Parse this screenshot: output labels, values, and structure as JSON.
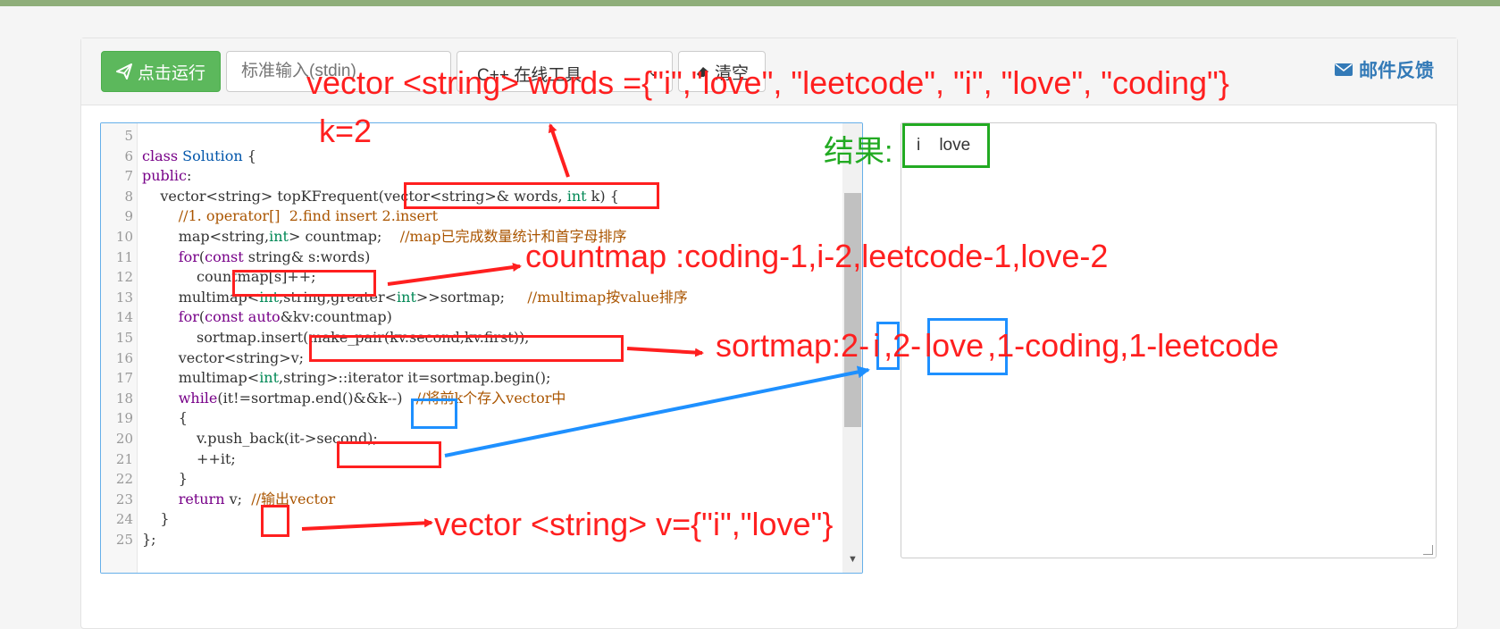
{
  "toolbar": {
    "run_label": "点击运行",
    "stdin_placeholder": "标准输入(stdin)",
    "language_selected": "C++ 在线工具",
    "clear_label": "清空",
    "feedback_label": "邮件反馈"
  },
  "editor": {
    "lines": [
      {
        "num": "5",
        "text": ""
      },
      {
        "num": "6",
        "text": "class Solution {"
      },
      {
        "num": "7",
        "text": "public:"
      },
      {
        "num": "8",
        "text": "    vector<string> topKFrequent(vector<string>& words, int k) {"
      },
      {
        "num": "9",
        "text": "        //1. operator[]  2.find insert 2.insert"
      },
      {
        "num": "10",
        "text": "        map<string,int> countmap;    //map已完成数量统计和首字母排序"
      },
      {
        "num": "11",
        "text": "        for(const string& s:words)"
      },
      {
        "num": "12",
        "text": "            countmap[s]++;"
      },
      {
        "num": "13",
        "text": "        multimap<int,string,greater<int>>sortmap;     //multimap按value排序"
      },
      {
        "num": "14",
        "text": "        for(const auto&kv:countmap)"
      },
      {
        "num": "15",
        "text": "            sortmap.insert(make_pair(kv.second,kv.first));"
      },
      {
        "num": "16",
        "text": "        vector<string>v;"
      },
      {
        "num": "17",
        "text": "        multimap<int,string>::iterator it=sortmap.begin();"
      },
      {
        "num": "18",
        "text": "        while(it!=sortmap.end()&&k--)   //将前k个存入vector中"
      },
      {
        "num": "19",
        "text": "        {"
      },
      {
        "num": "20",
        "text": "            v.push_back(it->second);"
      },
      {
        "num": "21",
        "text": "            ++it;"
      },
      {
        "num": "22",
        "text": "        }"
      },
      {
        "num": "23",
        "text": "        return v;  //输出vector"
      },
      {
        "num": "24",
        "text": "    }"
      },
      {
        "num": "25",
        "text": "};"
      }
    ]
  },
  "output": {
    "text": "i    love"
  },
  "annotations": {
    "words": "vector <string> words ={\"i\",\"love\", \"leetcode\", \"i\", \"love\", \"coding\"}",
    "k": "k=2",
    "result_label": "结果:",
    "countmap": "countmap :coding-1,i-2,leetcode-1,love-2",
    "sortmap_prefix": "sortmap:2-",
    "sortmap_i": "i",
    "sortmap_mid": ",2-",
    "sortmap_love": "love",
    "sortmap_rest": ",1-coding,1-leetcode",
    "vresult": "vector <string> v={\"i\",\"love\"}"
  },
  "colors": {
    "annotation_red": "#ff1f1f",
    "annotation_blue": "#1e90ff",
    "annotation_green": "#22aa22",
    "run_button": "#5cb85c",
    "link_blue": "#337ab7"
  },
  "icons": {
    "run": "paper-plane-icon",
    "clear": "eraser-icon",
    "feedback": "envelope-icon",
    "select": "chevron-down-icon"
  }
}
